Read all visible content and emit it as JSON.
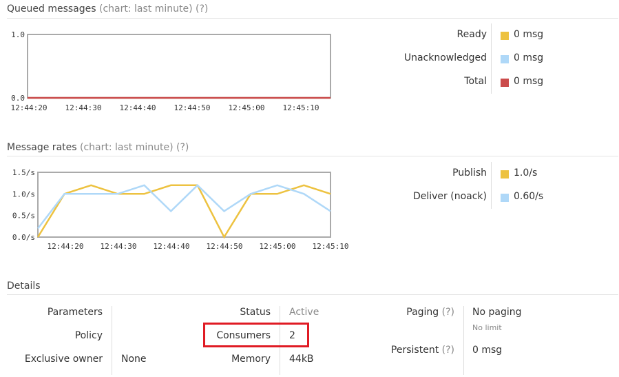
{
  "queued": {
    "title": "Queued messages",
    "subtitle": "(chart: last minute) (?)",
    "legend": [
      {
        "label": "Ready",
        "value": "0 msg",
        "color": "#edc240"
      },
      {
        "label": "Unacknowledged",
        "value": "0 msg",
        "color": "#afd8f8"
      },
      {
        "label": "Total",
        "value": "0 msg",
        "color": "#cb4b4b"
      }
    ]
  },
  "rates": {
    "title": "Message rates",
    "subtitle": "(chart: last minute) (?)",
    "legend": [
      {
        "label": "Publish",
        "value": "1.0/s",
        "color": "#edc240"
      },
      {
        "label": "Deliver (noack)",
        "value": "0.60/s",
        "color": "#afd8f8"
      }
    ]
  },
  "details": {
    "title": "Details",
    "parameters_label": "Parameters",
    "policy_label": "Policy",
    "exclusive_owner_label": "Exclusive owner",
    "exclusive_owner_value": "None",
    "status_label": "Status",
    "status_value": "Active",
    "consumers_label": "Consumers",
    "consumers_value": "2",
    "memory_label": "Memory",
    "memory_value": "44kB",
    "paging_label": "Paging",
    "paging_help": "(?)",
    "paging_value": "No paging",
    "paging_sub": "No limit",
    "persistent_label": "Persistent",
    "persistent_help": "(?)",
    "persistent_value": "0 msg"
  },
  "chart_data": [
    {
      "type": "line",
      "ytick_labels": [
        "0.0",
        "1.0"
      ],
      "xtick_labels": [
        "12:44:20",
        "12:44:30",
        "12:44:40",
        "12:44:50",
        "12:45:00",
        "12:45:10"
      ],
      "ylim": [
        0,
        1.0
      ],
      "series": [
        {
          "name": "Ready",
          "color": "#edc240",
          "values": [
            0,
            0,
            0,
            0,
            0,
            0,
            0
          ]
        },
        {
          "name": "Unacknowledged",
          "color": "#afd8f8",
          "values": [
            0,
            0,
            0,
            0,
            0,
            0,
            0
          ]
        },
        {
          "name": "Total",
          "color": "#cb4b4b",
          "values": [
            0,
            0,
            0,
            0,
            0,
            0,
            0
          ]
        }
      ]
    },
    {
      "type": "line",
      "ytick_labels": [
        "0.0/s",
        "0.5/s",
        "1.0/s",
        "1.5/s"
      ],
      "xtick_labels": [
        "12:44:20",
        "12:44:30",
        "12:44:40",
        "12:44:50",
        "12:45:00",
        "12:45:10"
      ],
      "ylim": [
        0,
        1.5
      ],
      "series": [
        {
          "name": "Publish",
          "color": "#edc240",
          "values": [
            0.0,
            1.0,
            1.2,
            1.0,
            1.0,
            1.2,
            1.2,
            0.0,
            1.0,
            1.0,
            1.2,
            1.0
          ]
        },
        {
          "name": "Deliver (noack)",
          "color": "#afd8f8",
          "values": [
            0.2,
            1.0,
            1.0,
            1.0,
            1.2,
            0.6,
            1.2,
            0.6,
            1.0,
            1.2,
            1.0,
            0.6
          ]
        }
      ]
    }
  ]
}
